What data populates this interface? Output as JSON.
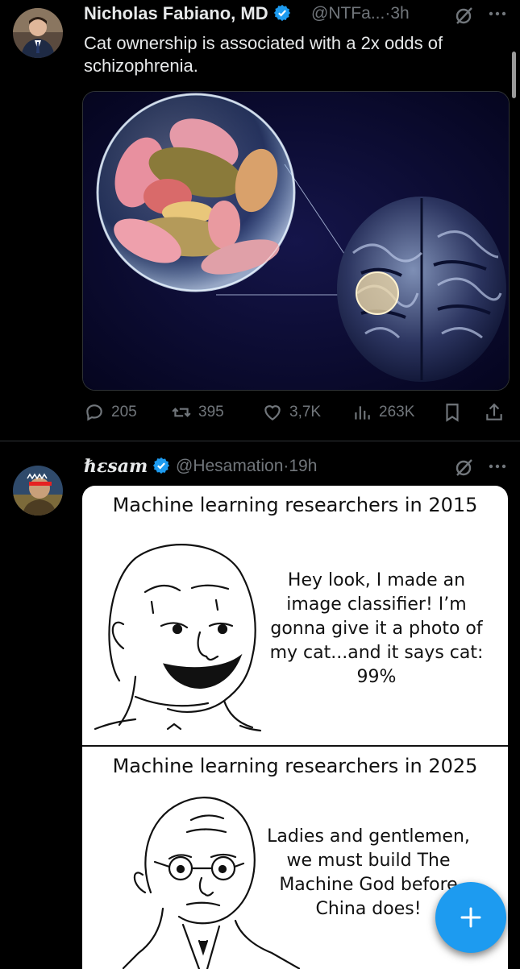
{
  "tweets": [
    {
      "display_name": "Nicholas Fabiano, MD",
      "handle": "@NTFa...",
      "time": "3h",
      "text": "Cat ownership is associated with a 2x odds of schizophrenia.",
      "stats": {
        "replies": "205",
        "reposts": "395",
        "likes": "3,7K",
        "views": "263K"
      }
    },
    {
      "display_name": "ℏεsam",
      "handle": "@Hesamation",
      "time": "19h",
      "meme": {
        "top_heading": "Machine learning researchers in 2015",
        "top_quote": "Hey look, I made an image classifier! I’m gonna give it a photo of my cat...and it says cat: 99%",
        "bottom_heading": "Machine learning researchers in 2025",
        "bottom_quote": "Ladies and gentlemen, we must build The Machine God before China does!"
      }
    }
  ],
  "separator": "·",
  "icons": {
    "verified": "verified-badge-icon",
    "grok": "grok-icon",
    "more": "more-icon",
    "reply": "reply-icon",
    "repost": "repost-icon",
    "like": "like-icon",
    "views": "views-icon",
    "bookmark": "bookmark-icon",
    "share": "share-icon",
    "compose": "compose-plus-icon"
  },
  "colors": {
    "accent": "#1d9bf0",
    "muted": "#71767b",
    "text": "#e7e9ea"
  }
}
